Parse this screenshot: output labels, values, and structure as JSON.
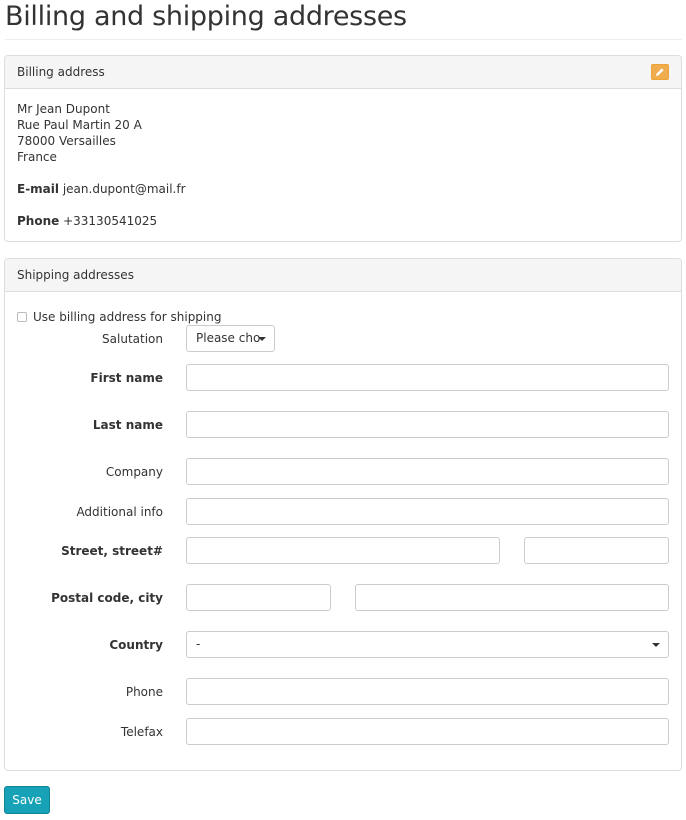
{
  "page_title": "Billing and shipping addresses",
  "billing": {
    "header": "Billing address",
    "name": "Mr Jean Dupont",
    "street": "Rue Paul Martin 20 A",
    "city": "78000 Versailles",
    "country": "France",
    "email_label": "E-mail",
    "email": "jean.dupont@mail.fr",
    "phone_label": "Phone",
    "phone": "+33130541025"
  },
  "shipping": {
    "header": "Shipping addresses",
    "use_billing_label": "Use billing address for shipping",
    "use_billing_checked": false,
    "salutation_label": "Salutation",
    "salutation_value": "Please cho",
    "first_name_label": "First name",
    "last_name_label": "Last name",
    "company_label": "Company",
    "additional_info_label": "Additional info",
    "street_label": "Street, street#",
    "postal_city_label": "Postal code, city",
    "country_label": "Country",
    "country_value": "-",
    "phone_label": "Phone",
    "telefax_label": "Telefax"
  },
  "save_label": "Save",
  "colors": {
    "edit_button": "#f0ad4e",
    "save_button": "#17a2b8"
  },
  "icons": {
    "edit": "pencil-icon",
    "dropdown": "caret-down-icon"
  }
}
